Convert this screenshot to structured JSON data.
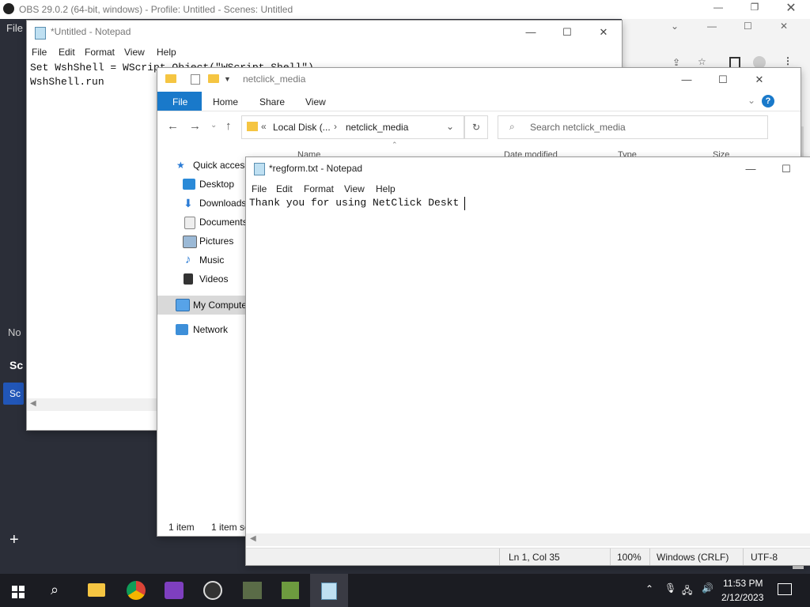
{
  "obs": {
    "title": "OBS 29.0.2 (64-bit, windows) - Profile: Untitled - Scenes: Untitled",
    "menu_file": "File",
    "left_no": "No",
    "left_sc1": "Sc",
    "left_sc2": "Sc",
    "add": "+"
  },
  "notepad_untitled": {
    "title": "*Untitled - Notepad",
    "menus": [
      "File",
      "Edit",
      "Format",
      "View",
      "Help"
    ],
    "line1": "Set WshShell = WScript.Object(\"WScript.Shell\")",
    "line2": "WshShell.run"
  },
  "explorer": {
    "title": "netclick_media",
    "ribbon_tabs": [
      "File",
      "Home",
      "Share",
      "View"
    ],
    "breadcrumb_root": "Local Disk (...",
    "breadcrumb_folder": "netclick_media",
    "search_placeholder": "Search netclick_media",
    "columns": [
      "Name",
      "Date modified",
      "Type",
      "Size"
    ],
    "nav": {
      "quick_access": "Quick access",
      "desktop": "Desktop",
      "downloads": "Downloads",
      "documents": "Documents",
      "pictures": "Pictures",
      "music": "Music",
      "videos": "Videos",
      "my_computer": "My Compute",
      "network": "Network"
    },
    "status_items": "1 item",
    "status_selected": "1 item se"
  },
  "notepad_regform": {
    "title": "*regform.txt - Notepad",
    "menus": [
      "File",
      "Edit",
      "Format",
      "View",
      "Help"
    ],
    "content": "Thank you for using NetClick Deskt",
    "status": {
      "position": "Ln 1, Col 35",
      "zoom": "100%",
      "line_endings": "Windows (CRLF)",
      "encoding": "UTF-8"
    }
  },
  "taskbar": {
    "time": "11:53 PM",
    "date": "2/12/2023"
  },
  "colors": {
    "accent": "#1979ca",
    "taskbar": "#1b1c22",
    "obs_dark": "#2b2e38"
  }
}
